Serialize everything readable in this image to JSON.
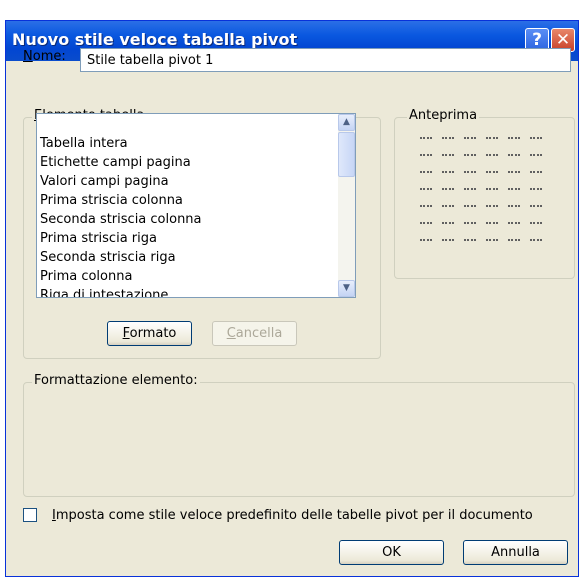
{
  "dialog": {
    "title": "Nuovo stile veloce tabella pivot",
    "help_glyph": "?",
    "close_glyph": "✕"
  },
  "name": {
    "label_u": "N",
    "label_rest": "ome:",
    "value": "Stile tabella pivot 1"
  },
  "element_group": {
    "title_u": "E",
    "title_rest": "lemento tabella",
    "items": [
      "Tabella intera",
      "Etichette campi pagina",
      "Valori campi pagina",
      "Prima striscia colonna",
      "Seconda striscia colonna",
      "Prima striscia riga",
      "Seconda striscia riga",
      "Prima colonna",
      "Riga di intestazione"
    ],
    "format_u": "F",
    "format_rest": "ormato",
    "clear_u": "C",
    "clear_rest": "ancella"
  },
  "preview": {
    "title": "Anteprima"
  },
  "formatting": {
    "title": "Formattazione elemento:"
  },
  "default_checkbox": {
    "label_u": "I",
    "label_rest": "mposta come stile veloce predefinito delle tabelle pivot per il documento",
    "checked": false
  },
  "footer": {
    "ok": "OK",
    "cancel": "Annulla"
  }
}
